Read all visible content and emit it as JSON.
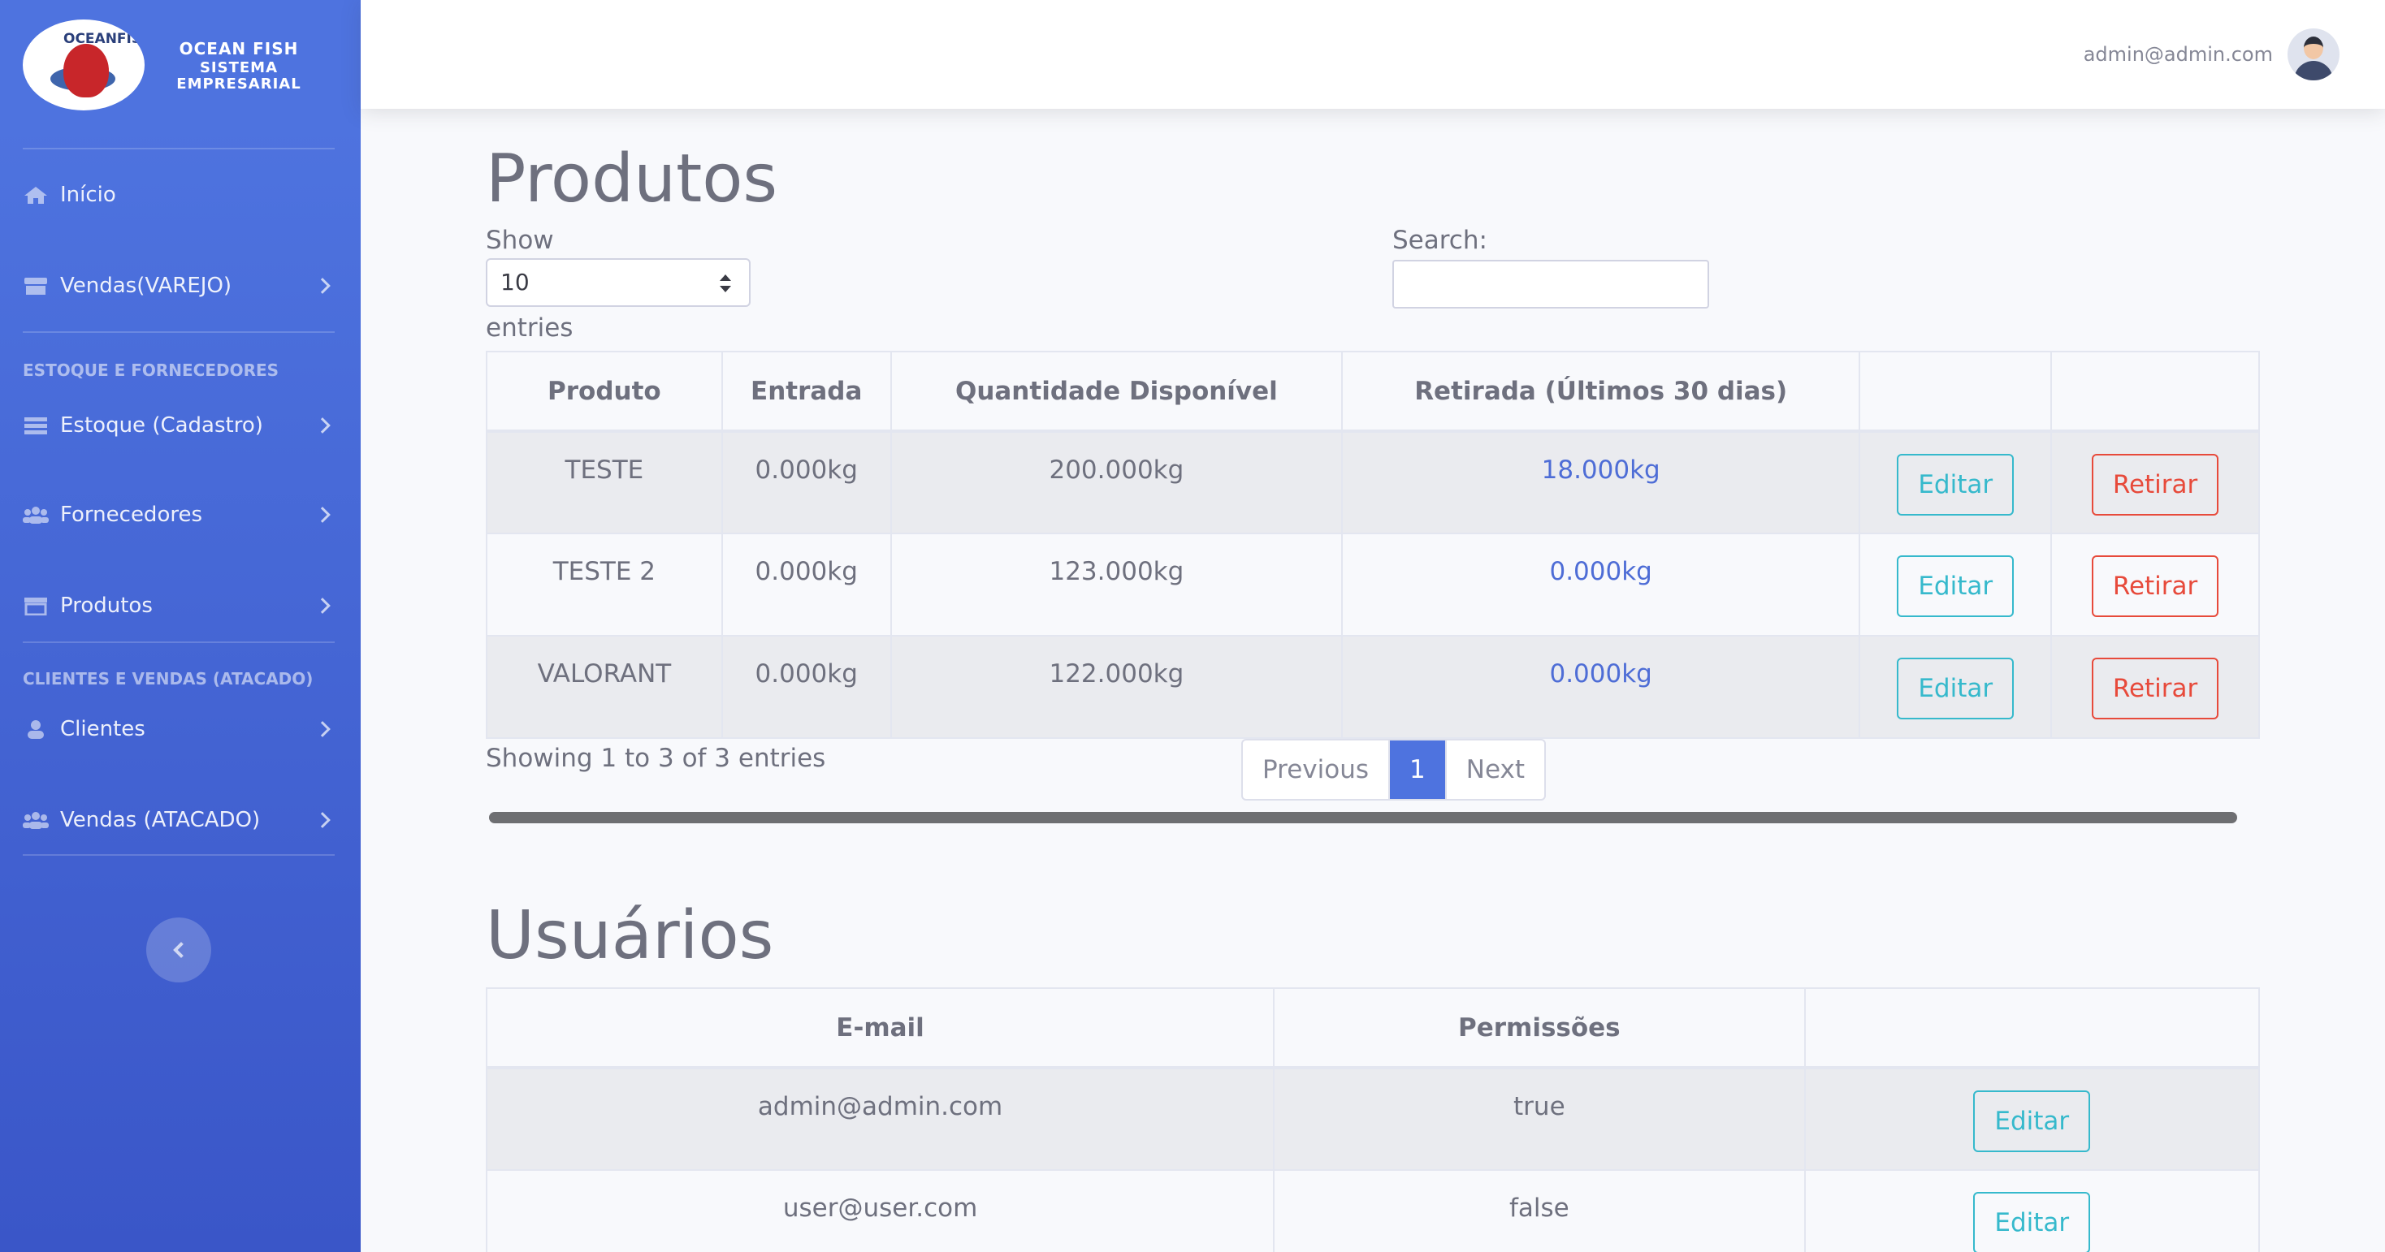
{
  "brand": {
    "logo_text": "OCEANFISH",
    "line1": "OCEAN FISH",
    "line2": "SISTEMA",
    "line3": "EMPRESARIAL"
  },
  "sidebar": {
    "items_top": [
      {
        "label": "Início",
        "icon": "home-icon"
      },
      {
        "label": "Vendas(VAREJO)",
        "icon": "store-icon"
      }
    ],
    "heading_stock": "ESTOQUE E FORNECEDORES",
    "items_stock": [
      {
        "label": "Estoque (Cadastro)",
        "icon": "list-icon"
      },
      {
        "label": "Fornecedores",
        "icon": "users-icon"
      },
      {
        "label": "Produtos",
        "icon": "store-icon"
      }
    ],
    "heading_clients": "CLIENTES E VENDAS (ATACADO)",
    "items_clients": [
      {
        "label": "Clientes",
        "icon": "user-icon"
      },
      {
        "label": "Vendas (ATACADO)",
        "icon": "users-icon"
      }
    ]
  },
  "topbar": {
    "user_email": "admin@admin.com"
  },
  "produtos": {
    "title": "Produtos",
    "show_label": "Show",
    "page_size": "10",
    "entries_label": "entries",
    "search_label": "Search:",
    "columns": [
      "Produto",
      "Entrada",
      "Quantidade Disponível",
      "Retirada (Últimos 30 dias)",
      "",
      ""
    ],
    "rows": [
      {
        "produto": "TESTE",
        "entrada": "0.000kg",
        "disponivel": "200.000kg",
        "retirada": "18.000kg",
        "edit": "Editar",
        "retirar": "Retirar"
      },
      {
        "produto": "TESTE 2",
        "entrada": "0.000kg",
        "disponivel": "123.000kg",
        "retirada": "0.000kg",
        "edit": "Editar",
        "retirar": "Retirar"
      },
      {
        "produto": "VALORANT",
        "entrada": "0.000kg",
        "disponivel": "122.000kg",
        "retirada": "0.000kg",
        "edit": "Editar",
        "retirar": "Retirar"
      }
    ],
    "showing": "Showing 1 to 3 of 3 entries",
    "pagination": {
      "prev": "Previous",
      "current": "1",
      "next": "Next"
    }
  },
  "usuarios": {
    "title": "Usuários",
    "columns": [
      "E-mail",
      "Permissões",
      ""
    ],
    "rows": [
      {
        "email": "admin@admin.com",
        "perm": "true",
        "edit": "Editar"
      },
      {
        "email": "user@user.com",
        "perm": "false",
        "edit": "Editar"
      }
    ]
  }
}
